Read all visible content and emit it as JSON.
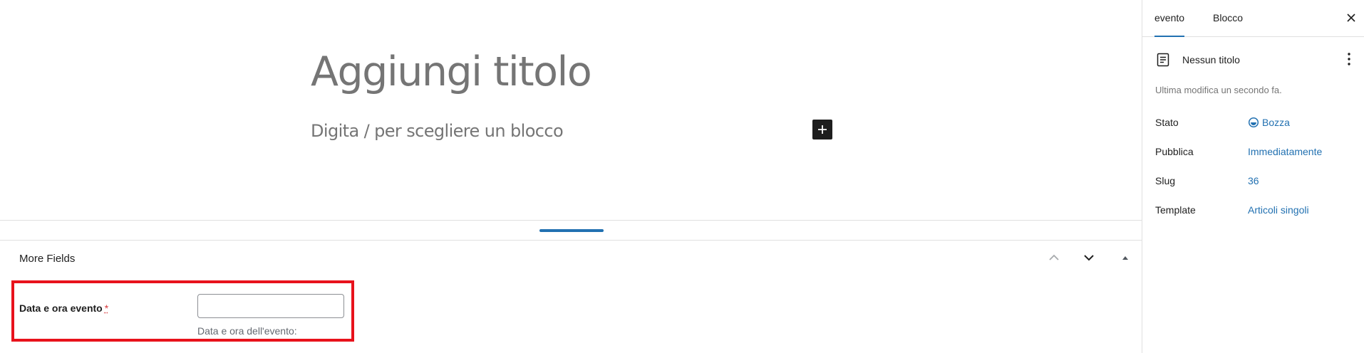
{
  "editor": {
    "title_placeholder": "Aggiungi titolo",
    "block_placeholder": "Digita / per scegliere un blocco",
    "add_block_icon": "plus-icon"
  },
  "meta_box": {
    "title": "More Fields",
    "field": {
      "label": "Data e ora evento",
      "required_mark": "*",
      "value": "",
      "description": "Data e ora dell'evento:"
    }
  },
  "sidebar": {
    "tabs": [
      {
        "label": "evento",
        "active": true
      },
      {
        "label": "Blocco",
        "active": false
      }
    ],
    "document": {
      "title": "Nessun titolo",
      "last_modified": "Ultima modifica un secondo fa."
    },
    "rows": [
      {
        "label": "Stato",
        "value": "Bozza"
      },
      {
        "label": "Pubblica",
        "value": "Immediatamente"
      },
      {
        "label": "Slug",
        "value": "36"
      },
      {
        "label": "Template",
        "value": "Articoli singoli"
      }
    ]
  },
  "colors": {
    "accent": "#2271b1",
    "highlight_border": "#e8121c"
  }
}
